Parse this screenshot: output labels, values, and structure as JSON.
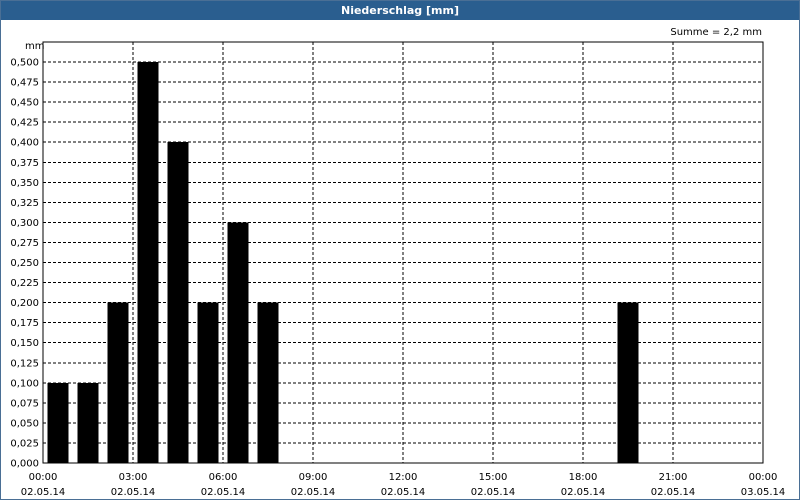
{
  "window": {
    "title": "Niederschlag [mm]"
  },
  "summary": "Summe = 2,2 mm",
  "chart_data": {
    "type": "bar",
    "title": "Niederschlag [mm]",
    "ylabel": "mm",
    "ylim": [
      0,
      0.525
    ],
    "grid": true,
    "yticks": [
      "0,000",
      "0,025",
      "0,050",
      "0,075",
      "0,100",
      "0,125",
      "0,150",
      "0,175",
      "0,200",
      "0,225",
      "0,250",
      "0,275",
      "0,300",
      "0,325",
      "0,350",
      "0,375",
      "0,400",
      "0,425",
      "0,450",
      "0,475",
      "0,500"
    ],
    "xticks": [
      {
        "time": "00:00",
        "date": "02.05.14"
      },
      {
        "time": "03:00",
        "date": "02.05.14"
      },
      {
        "time": "06:00",
        "date": "02.05.14"
      },
      {
        "time": "09:00",
        "date": "02.05.14"
      },
      {
        "time": "12:00",
        "date": "02.05.14"
      },
      {
        "time": "15:00",
        "date": "02.05.14"
      },
      {
        "time": "18:00",
        "date": "02.05.14"
      },
      {
        "time": "21:00",
        "date": "02.05.14"
      },
      {
        "time": "00:00",
        "date": "03.05.14"
      }
    ],
    "x_range": [
      "02.05.14 00:00",
      "03.05.14 00:00"
    ],
    "bars": [
      {
        "start": "02.05.14 00:00",
        "end": "02.05.14 01:00",
        "value": 0.1
      },
      {
        "start": "02.05.14 01:00",
        "end": "02.05.14 02:00",
        "value": 0.1
      },
      {
        "start": "02.05.14 02:00",
        "end": "02.05.14 03:00",
        "value": 0.2
      },
      {
        "start": "02.05.14 03:00",
        "end": "02.05.14 04:00",
        "value": 0.5
      },
      {
        "start": "02.05.14 04:00",
        "end": "02.05.14 05:00",
        "value": 0.4
      },
      {
        "start": "02.05.14 05:00",
        "end": "02.05.14 06:00",
        "value": 0.2
      },
      {
        "start": "02.05.14 06:00",
        "end": "02.05.14 07:00",
        "value": 0.3
      },
      {
        "start": "02.05.14 07:00",
        "end": "02.05.14 08:00",
        "value": 0.2
      },
      {
        "start": "02.05.14 19:00",
        "end": "02.05.14 20:00",
        "value": 0.2
      }
    ],
    "bar_color": "#000000"
  }
}
